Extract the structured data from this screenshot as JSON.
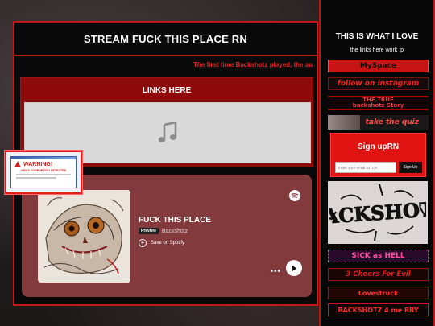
{
  "main": {
    "header_title": "STREAM FUCK THIS PLACE RN",
    "marquee_text": "The first time Backshotz played, the au",
    "links_title": "LINKS HERE"
  },
  "embed": {
    "track_title": "FUCK THIS PLACE",
    "preview_label": "Preview",
    "artist": "Backshotz",
    "save_label": "Save on Spotify",
    "more_label": "•••"
  },
  "warning_popup": {
    "title": "WARNING!",
    "subtitle": "VIRUS CORRUPTION DETECTED"
  },
  "sidebar": {
    "title": "THIS IS WHAT I LOVE",
    "subtitle": "the links here work ;p",
    "stamps": [
      "MySpace",
      "follow on instagram",
      "THE TRUE",
      "backshotz Story",
      "take the quiz",
      "SICK as HELL",
      "3 Cheers For Evil",
      "Lovestruck",
      "BACKSHOTZ 4 me BBY"
    ],
    "signup": {
      "title": "Sign upRN",
      "email_placeholder": "Enter your email BITCH",
      "button_label": "Sign Up"
    },
    "logo_text": "BACKSHOTZ"
  },
  "colors": {
    "accent_red": "#c41919",
    "embed_bg": "#823a3c",
    "links_bg": "#8d0b0b"
  }
}
